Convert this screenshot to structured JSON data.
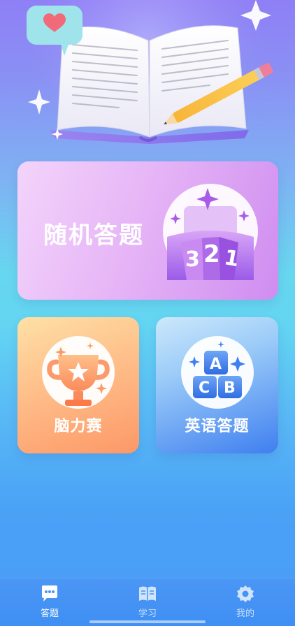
{
  "cards": {
    "random_quiz": "随机答题",
    "brain_race": "脑力赛",
    "english_quiz": "英语答题"
  },
  "tabbar": [
    {
      "label": "答题",
      "icon": "chat-icon",
      "active": true
    },
    {
      "label": "学习",
      "icon": "book-icon",
      "active": false
    },
    {
      "label": "我的",
      "icon": "gear-icon",
      "active": false
    }
  ],
  "colors": {
    "random_card": "#e6b5f6",
    "brain_card": "#ffc28d",
    "english_card": "#3f7ff0",
    "tabbar": "#4196f5"
  }
}
